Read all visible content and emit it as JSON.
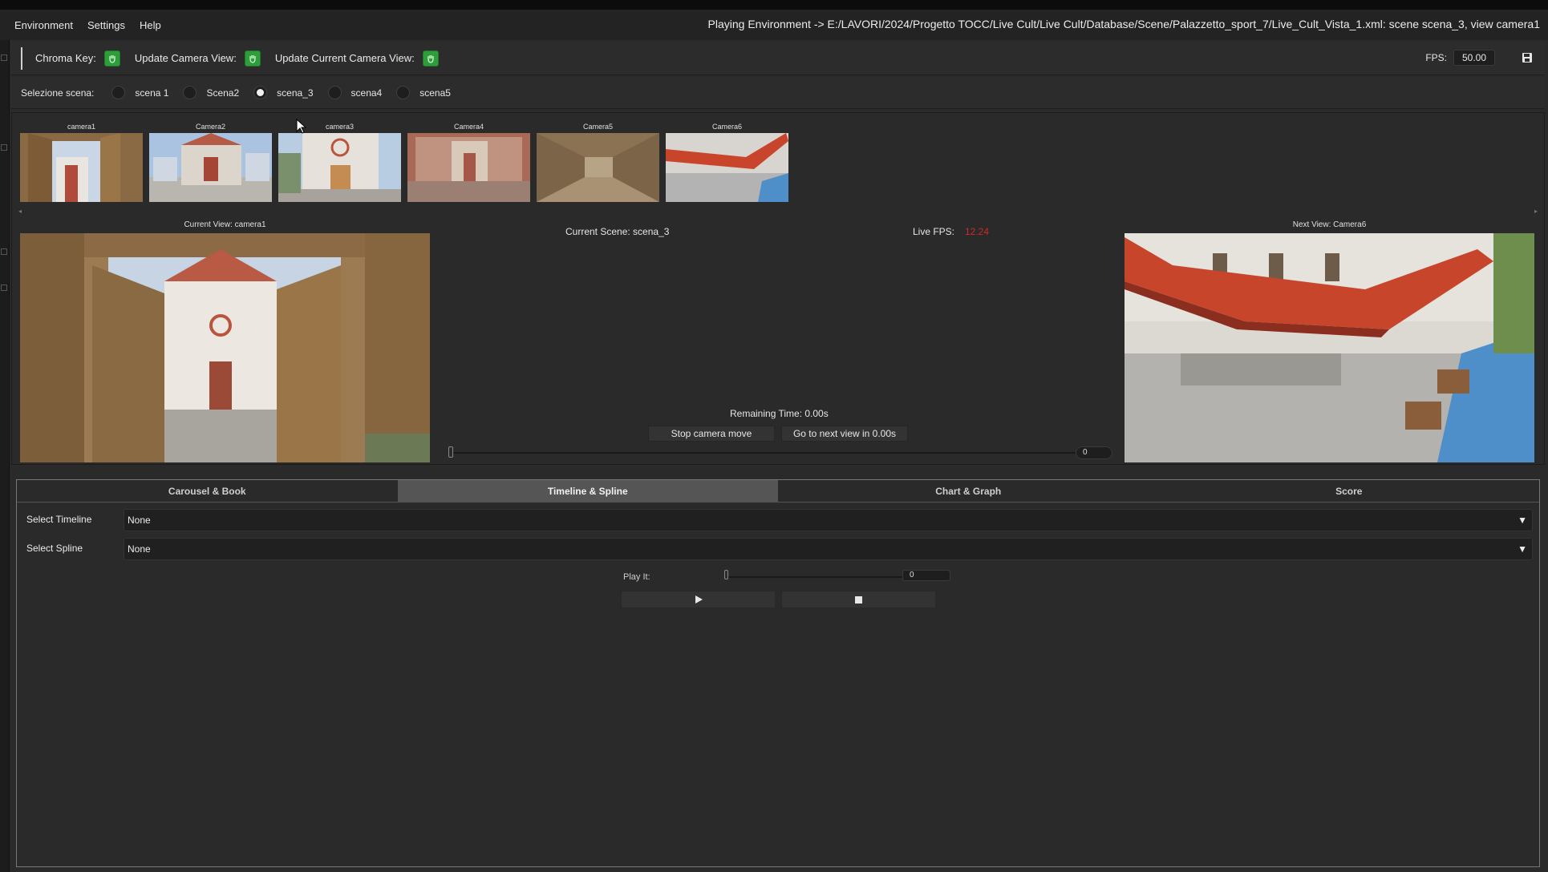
{
  "menubar": {
    "items": [
      "Environment",
      "Settings",
      "Help"
    ],
    "window_title": "Playing Environment -> E:/LAVORI/2024/Progetto TOCC/Live Cult/Live Cult/Database/Scene/Palazzetto_sport_7/Live_Cult_Vista_1.xml: scene scena_3, view camera1"
  },
  "toolbar": {
    "chroma_key_label": "Chroma Key:",
    "update_camera_view_label": "Update Camera View:",
    "update_current_camera_view_label": "Update Current Camera View:",
    "fps_label": "FPS:",
    "fps_value": "50.00",
    "button_icon": "hand-icon",
    "save_icon": "save-icon"
  },
  "scene_selector": {
    "label": "Selezione scena:",
    "options": [
      {
        "label": "scena 1",
        "selected": false
      },
      {
        "label": "Scena2",
        "selected": false
      },
      {
        "label": "scena_3",
        "selected": true
      },
      {
        "label": "scena4",
        "selected": false
      },
      {
        "label": "scena5",
        "selected": false
      }
    ]
  },
  "cameras": [
    "camera1",
    "Camera2",
    "camera3",
    "Camera4",
    "Camera5",
    "Camera6"
  ],
  "current_view": {
    "title": "Current View: camera1"
  },
  "next_view": {
    "title": "Next View: Camera6"
  },
  "status": {
    "current_scene": "Current Scene: scena_3",
    "live_fps_label": "Live FPS:",
    "live_fps_value": "12.24",
    "remaining_time": "Remaining Time: 0.00s",
    "stop_button": "Stop camera move",
    "next_button": "Go to next view in 0.00s",
    "slider_value": "0"
  },
  "tabs": [
    {
      "label": "Carousel & Book",
      "active": false
    },
    {
      "label": "Timeline & Spline",
      "active": true
    },
    {
      "label": "Chart & Graph",
      "active": false
    },
    {
      "label": "Score",
      "active": false
    }
  ],
  "timeline_tab": {
    "select_timeline_label": "Select Timeline",
    "select_timeline_value": "None",
    "select_spline_label": "Select Spline",
    "select_spline_value": "None",
    "play_label": "Play It:",
    "play_value": "0"
  },
  "colors": {
    "accent_green": "#2e9e3a",
    "live_fps_red": "#d22828",
    "active_tab": "#555555"
  }
}
